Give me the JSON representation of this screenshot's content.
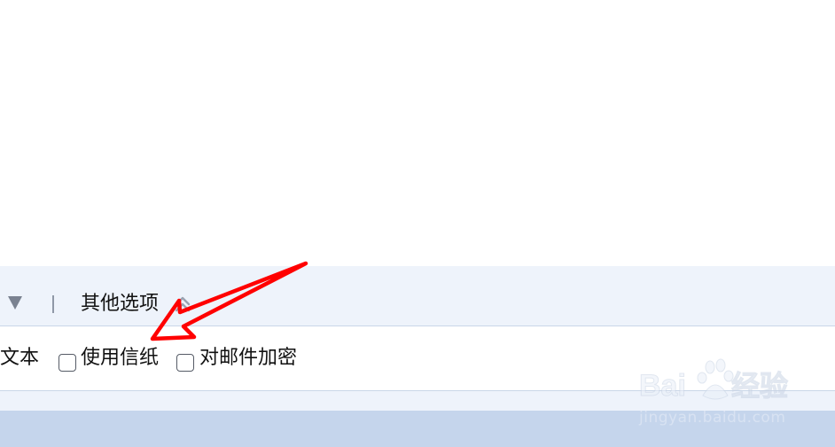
{
  "options_bar": {
    "title": "其他选项",
    "expand_icon": "triangle-down-icon",
    "collapse_icon": "double-chevron-up-icon"
  },
  "checkbox_row": {
    "partial_label": "文本",
    "options": [
      {
        "label": "使用信纸",
        "checked": false
      },
      {
        "label": "对邮件加密",
        "checked": false
      }
    ]
  },
  "watermark": {
    "logo": "Baidu经验",
    "url": "jingyan.baidu.com"
  },
  "colors": {
    "options_bar_bg": "#eef3fb",
    "bottom_bar_bg": "#c5d5ec",
    "annotation_arrow": "#ff0000",
    "text": "#111111"
  }
}
